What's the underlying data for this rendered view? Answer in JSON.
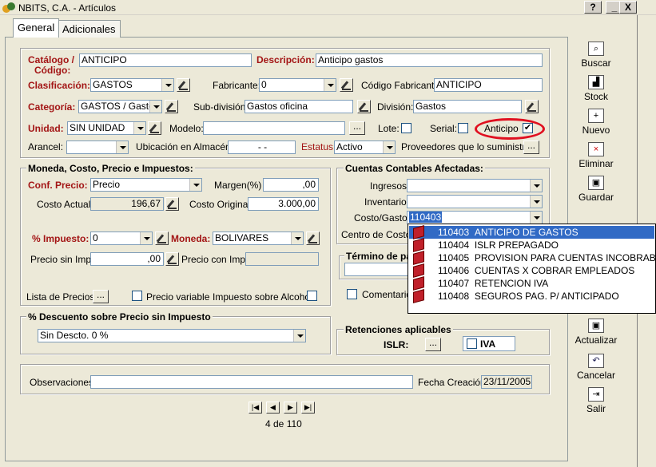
{
  "window": {
    "title": "NBITS, C.A. - Artículos",
    "help": "?",
    "minimize": "_",
    "close": "X"
  },
  "tabs": [
    "General",
    "Adicionales"
  ],
  "fields": {
    "catalogo_label": "Catálogo /",
    "codigo_label": "Código:",
    "catalogo_value": "ANTICIPO",
    "descripcion_label": "Descripción:",
    "descripcion_value": "Anticipo gastos",
    "clasificacion_label": "Clasificación:",
    "clasificacion_value": "GASTOS",
    "fabricante_label": "Fabricante:",
    "fabricante_value": "0",
    "codigo_fabricante_label": "Código Fabricante:",
    "codigo_fabricante_value": "ANTICIPO",
    "categoria_label": "Categoría:",
    "categoria_value": "GASTOS / Gasto",
    "subdivision_label": "Sub-división:",
    "subdivision_value": "Gastos oficina",
    "division_label": "División:",
    "division_value": "Gastos",
    "unidad_label": "Unidad:",
    "unidad_value": "SIN UNIDAD",
    "modelo_label": "Modelo:",
    "modelo_value": "",
    "lote_label": "Lote:",
    "serial_label": "Serial:",
    "anticipo_label": "Anticipo",
    "anticipo_check": "✔",
    "arancel_label": "Arancel:",
    "arancel_value": "",
    "ubicacion_label": "Ubicación en Almacén:",
    "ubicacion_value": "-   -",
    "estatus_label": "Estatus:",
    "estatus_value": "Activo",
    "proveedores_label": "Proveedores que lo suministran:"
  },
  "moneda": {
    "title": "Moneda, Costo, Precio e Impuestos:",
    "conf_precio_label": "Conf. Precio:",
    "conf_precio_value": "Precio",
    "margen_label": "Margen(%)",
    "margen_value": ",00",
    "costo_actual_label": "Costo Actual:",
    "costo_actual_value": "196,67",
    "costo_original_label": "Costo Original:",
    "costo_original_value": "3.000,00",
    "impuesto_label": "% Impuesto:",
    "impuesto_value": "0",
    "moneda_label": "Moneda:",
    "moneda_value": "BOLIVARES",
    "precio_sin_label": "Precio sin Imp.:",
    "precio_sin_value": ",00",
    "precio_con_label": "Precio con Imp.:",
    "precio_con_value": "",
    "lista_label": "Lista de Precios:",
    "precio_variable_label": "Precio variable",
    "impuesto_alcohol_label": "Impuesto sobre Alcohol:"
  },
  "cuentas": {
    "title": "Cuentas Contables Afectadas:",
    "ingresos_label": "Ingresos:",
    "inventario_label": "Inventario:",
    "costo_gasto_label": "Costo/Gasto:",
    "costo_gasto_value": "110403",
    "centro_label": "Centro de Costo:",
    "termino_label": "Término de pa",
    "comentario_label": "Comentario"
  },
  "dropdown": [
    {
      "code": "110403",
      "name": "ANTICIPO DE GASTOS"
    },
    {
      "code": "110404",
      "name": "ISLR PREPAGADO"
    },
    {
      "code": "110405",
      "name": "PROVISION PARA CUENTAS INCOBRABLES"
    },
    {
      "code": "110406",
      "name": "CUENTAS X COBRAR EMPLEADOS"
    },
    {
      "code": "110407",
      "name": "RETENCION IVA"
    },
    {
      "code": "110408",
      "name": "SEGUROS PAG. P/ ANTICIPADO"
    }
  ],
  "descuento": {
    "title": "% Descuento sobre Precio sin Impuesto",
    "value": "Sin Descto. 0 %"
  },
  "retenciones": {
    "title": "Retenciones aplicables",
    "islr_label": "ISLR:",
    "iva_label": "IVA"
  },
  "obs": {
    "label": "Observaciones:",
    "value": "",
    "fecha_label": "Fecha Creación:",
    "fecha_value": "23/11/2005"
  },
  "nav": {
    "record": "4 de 110"
  },
  "sidebar": [
    "Buscar",
    "Stock",
    "Nuevo",
    "Eliminar",
    "Guardar",
    "Actualizar",
    "Cancelar",
    "Salir"
  ],
  "colors": {
    "accent_red": "#a31515",
    "selection": "#316ac5",
    "highlight": "#e01020"
  }
}
